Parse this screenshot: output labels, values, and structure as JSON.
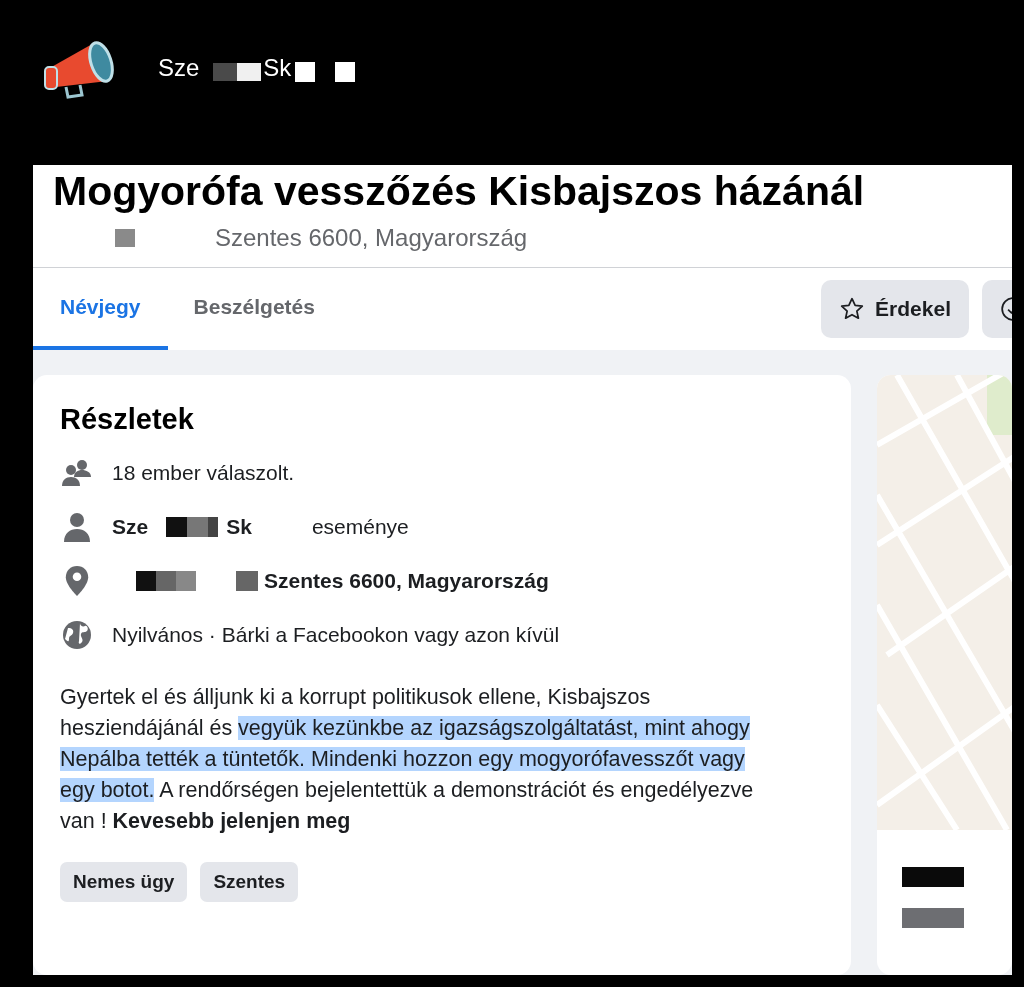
{
  "header": {
    "name_parts": [
      "Sze",
      "Sk"
    ]
  },
  "event": {
    "title": "Mogyorófa vesszőzés Kisbajszos házánál",
    "location": "Szentes 6600, Magyarország"
  },
  "tabs": [
    {
      "label": "Névjegy",
      "selected": true
    },
    {
      "label": "Beszélgetés",
      "selected": false
    }
  ],
  "actions": [
    {
      "kind": "star",
      "label": "Érdekel"
    },
    {
      "kind": "check"
    }
  ],
  "details": {
    "title": "Részletek",
    "rows": [
      {
        "kind": "people",
        "text": "18 ember válaszolt."
      },
      {
        "kind": "host",
        "name_parts": [
          "Sze",
          "Sk"
        ],
        "text": "eseménye"
      },
      {
        "kind": "place",
        "text": "Szentes 6600, Magyarország"
      },
      {
        "kind": "globe",
        "text": "Nyilvános · Bárki a Facebookon vagy azon kívül"
      }
    ],
    "description": [
      {
        "text": "Gyertek el és álljunk ki a korrupt politikusok ellene, Kisbajszos hesziendájánál és ",
        "highlighted": false
      },
      {
        "text": "vegyük kezünkbe az igazságszolgáltatást, mint ahogy Nepálba tették a tüntetők. Mindenki hozzon egy mogyorófavesszőt vagy egy botot.",
        "highlighted": true
      },
      {
        "text": " A rendőrségen bejelentettük a demonstrációt és engedélyezve van ! ",
        "highlighted": false
      },
      {
        "text": "**Kevesebb jelenjen meg**",
        "highlighted": false
      }
    ],
    "tags": [
      "Nemes ügy",
      "Szentes"
    ]
  }
}
